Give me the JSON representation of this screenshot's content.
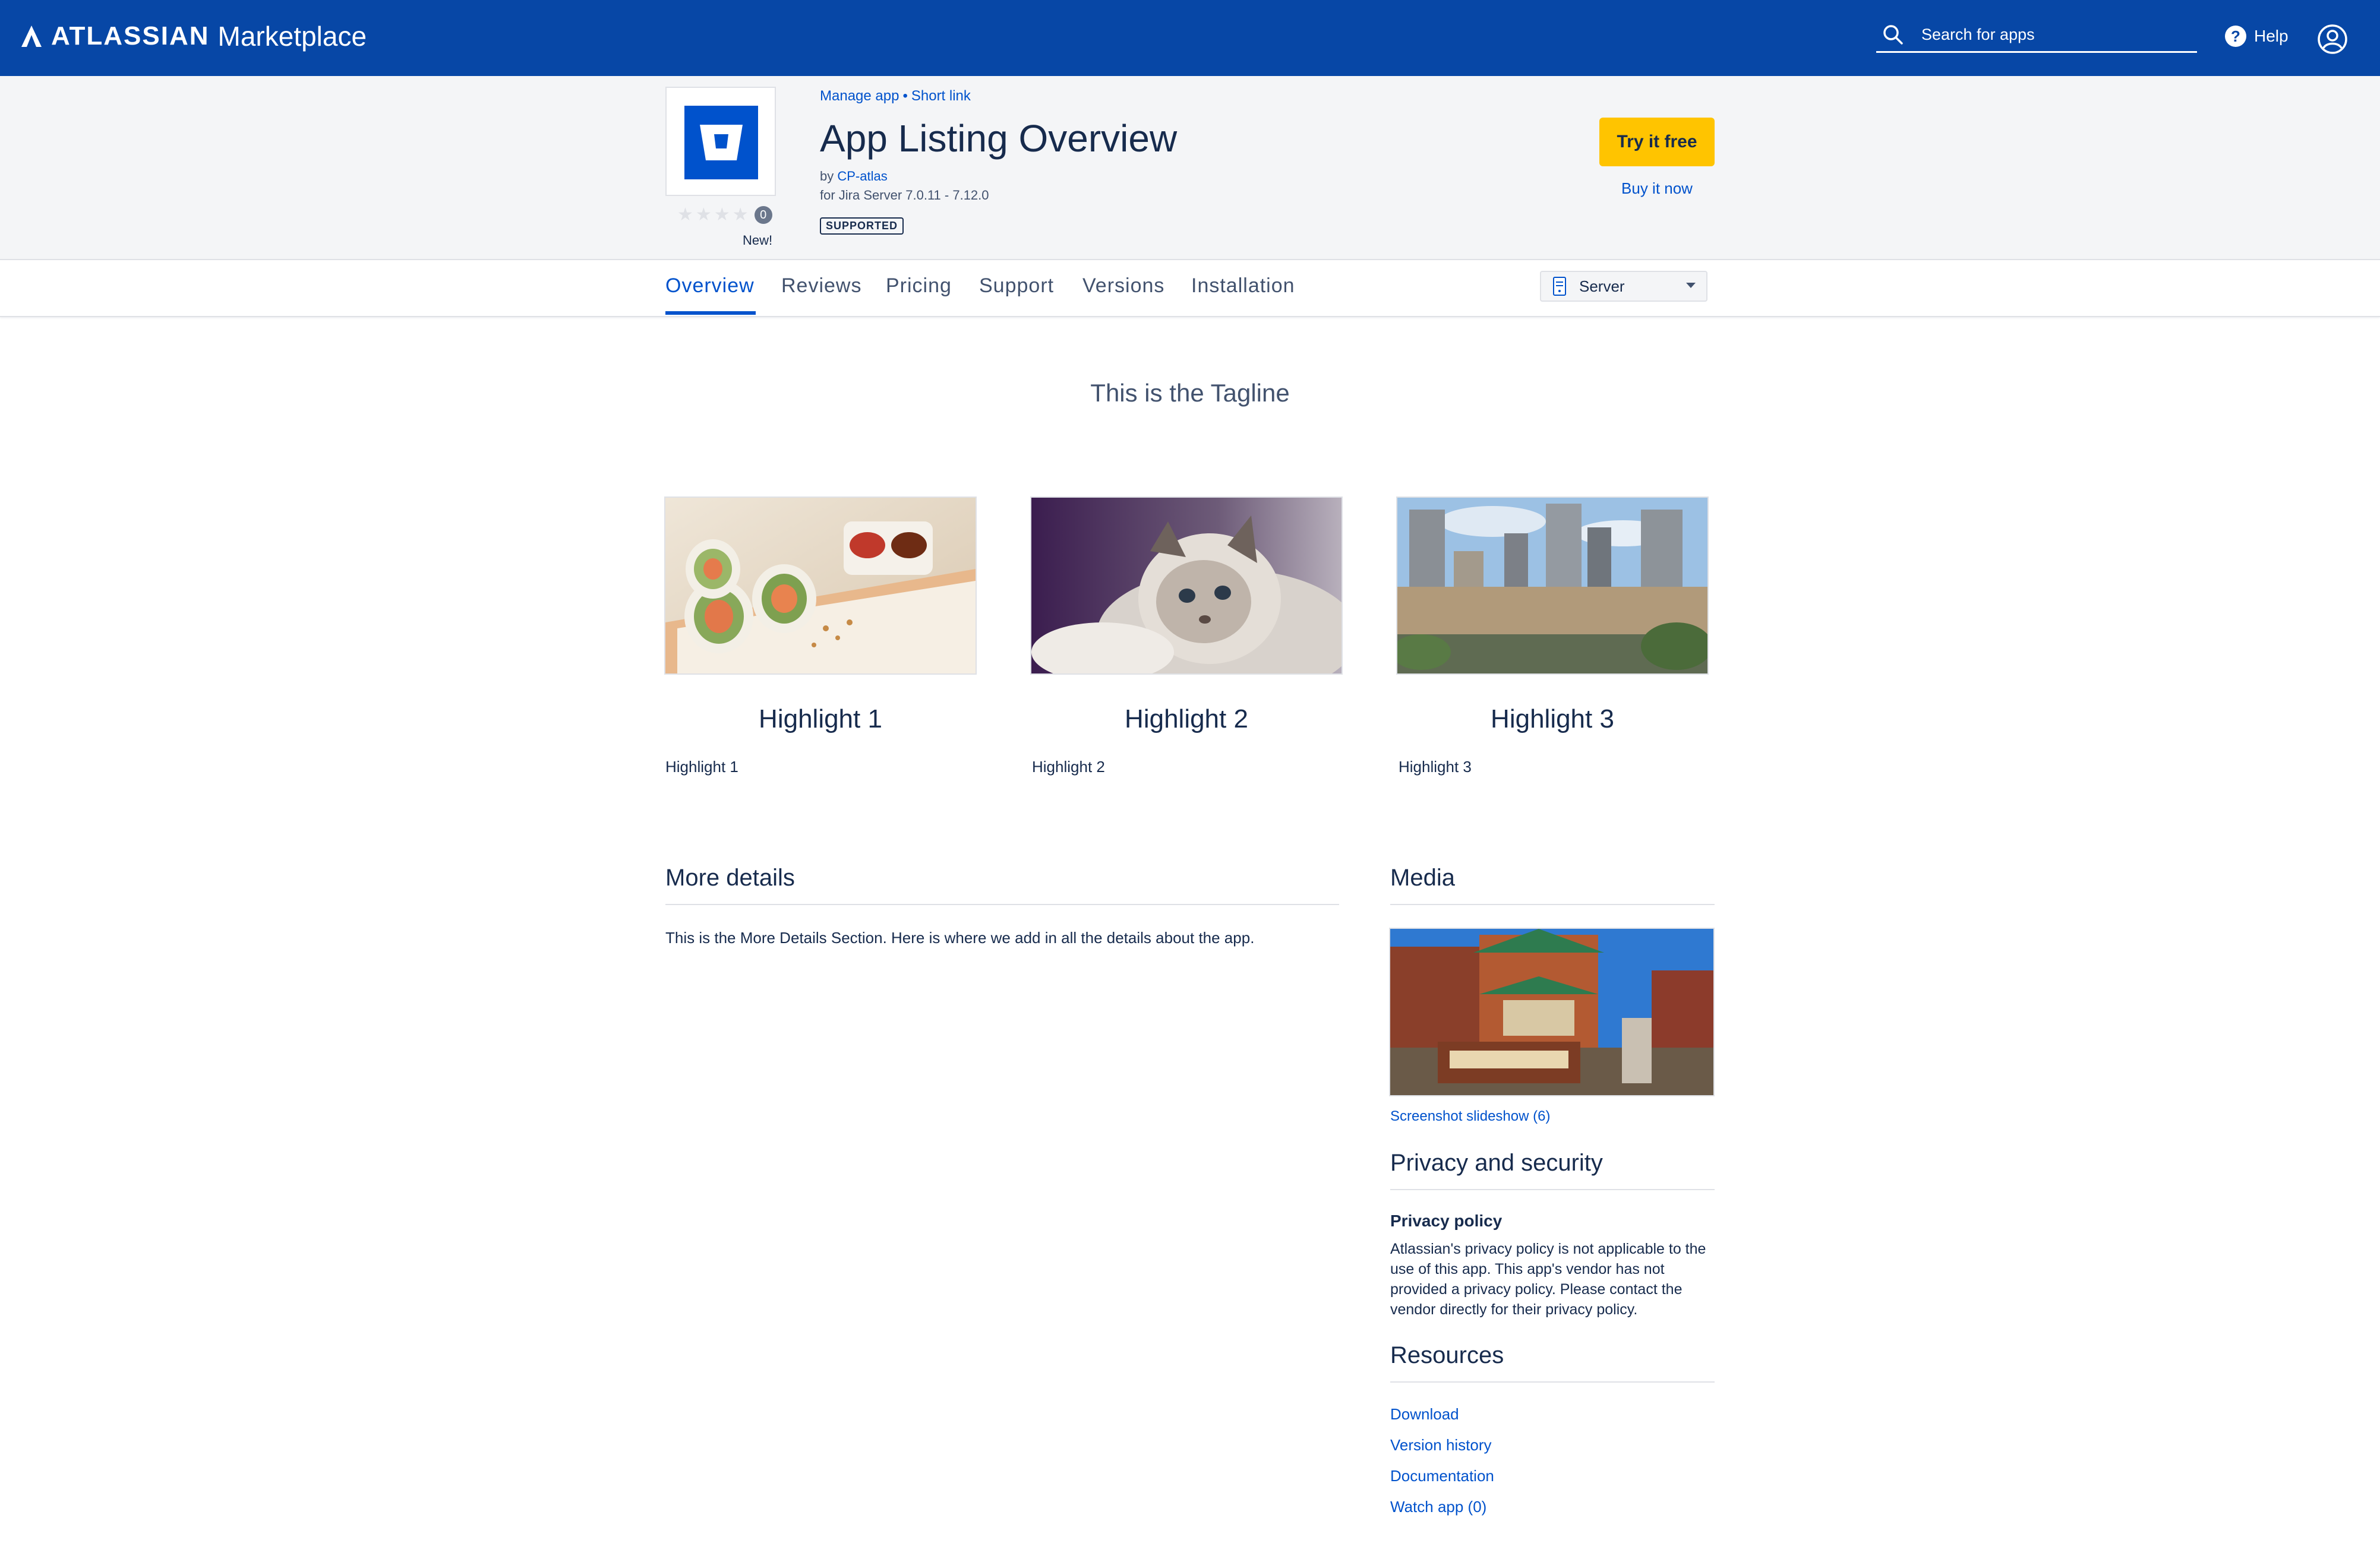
{
  "topbar": {
    "brand_atlassian": "ATLASSIAN",
    "brand_marketplace": "Marketplace",
    "search_placeholder": "Search for apps",
    "help_label": "Help",
    "bg_color": "#0747a6"
  },
  "header": {
    "manage_link": "Manage app",
    "short_link": "Short link",
    "separator": "•",
    "title": "App Listing Overview",
    "by_prefix": "by",
    "vendor": "CP-atlas",
    "compatibility": "for Jira Server 7.0.11 - 7.12.0",
    "rating_count": "0",
    "new_label": "New!",
    "support_badge": "SUPPORTED",
    "try_button": "Try it free",
    "buy_link": "Buy it now",
    "accent_color": "#ffc400"
  },
  "tabs": {
    "items": [
      "Overview",
      "Reviews",
      "Pricing",
      "Support",
      "Versions",
      "Installation"
    ],
    "active": "Overview",
    "hosting_selected": "Server"
  },
  "main": {
    "tagline": "This is the Tagline",
    "highlights": [
      {
        "title": "Highlight 1",
        "text": "Highlight 1",
        "image": "spring-rolls-photo"
      },
      {
        "title": "Highlight 2",
        "text": "Highlight 2",
        "image": "cat-photo"
      },
      {
        "title": "Highlight 3",
        "text": "Highlight 3",
        "image": "city-skyline-photo"
      }
    ],
    "more_details_title": "More details",
    "more_details_text": "This is the More Details Section. Here is where we add in all the details about the app."
  },
  "sidebar": {
    "media_title": "Media",
    "slideshow_link": "Screenshot slideshow (6)",
    "privacy_title": "Privacy and security",
    "privacy_policy_heading": "Privacy policy",
    "privacy_policy_text": "Atlassian's privacy policy is not applicable to the use of this app. This app's vendor has not provided a privacy policy. Please contact the vendor directly for their privacy policy.",
    "resources_title": "Resources",
    "resources": [
      "Download",
      "Version history",
      "Documentation",
      "Watch app (0)"
    ]
  }
}
